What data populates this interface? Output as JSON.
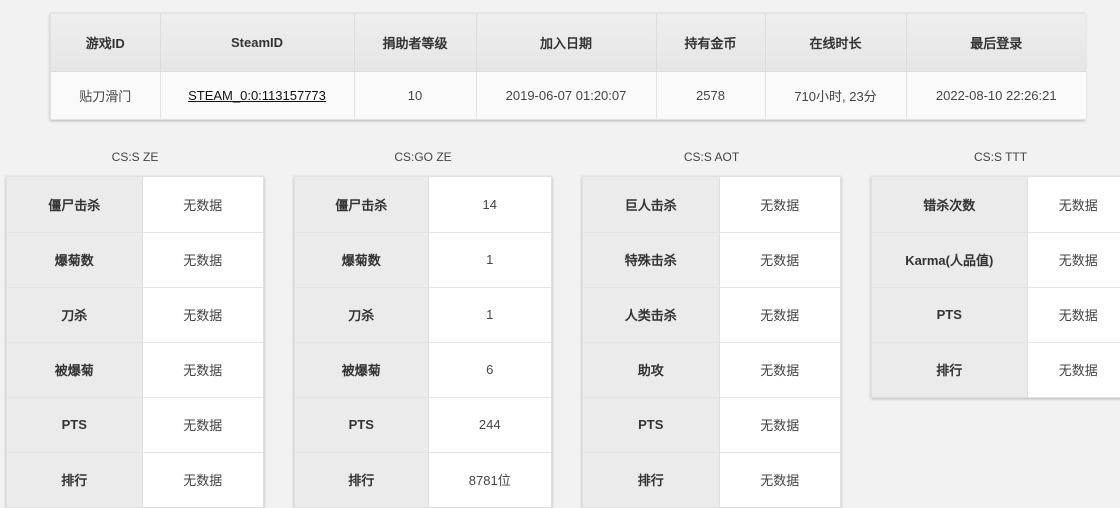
{
  "profile": {
    "headers": [
      "游戏ID",
      "SteamID",
      "捐助者等级",
      "加入日期",
      "持有金币",
      "在线时长",
      "最后登录"
    ],
    "values": {
      "game_id": "贴刀滑门",
      "steam_id": "STEAM_0:0:113157773",
      "donor_level": "10",
      "join_date": "2019-06-07 01:20:07",
      "coins": "2578",
      "online_time": "710小时, 23分",
      "last_login": "2022-08-10 22:26:21"
    }
  },
  "sections": [
    {
      "title": "CS:S ZE",
      "rows": [
        {
          "label": "僵尸击杀",
          "value": "无数据"
        },
        {
          "label": "爆菊数",
          "value": "无数据"
        },
        {
          "label": "刀杀",
          "value": "无数据"
        },
        {
          "label": "被爆菊",
          "value": "无数据"
        },
        {
          "label": "PTS",
          "value": "无数据"
        },
        {
          "label": "排行",
          "value": "无数据"
        }
      ]
    },
    {
      "title": "CS:GO ZE",
      "rows": [
        {
          "label": "僵尸击杀",
          "value": "14"
        },
        {
          "label": "爆菊数",
          "value": "1"
        },
        {
          "label": "刀杀",
          "value": "1"
        },
        {
          "label": "被爆菊",
          "value": "6"
        },
        {
          "label": "PTS",
          "value": "244"
        },
        {
          "label": "排行",
          "value": "8781位"
        }
      ]
    },
    {
      "title": "CS:S AOT",
      "rows": [
        {
          "label": "巨人击杀",
          "value": "无数据"
        },
        {
          "label": "特殊击杀",
          "value": "无数据"
        },
        {
          "label": "人类击杀",
          "value": "无数据"
        },
        {
          "label": "助攻",
          "value": "无数据"
        },
        {
          "label": "PTS",
          "value": "无数据"
        },
        {
          "label": "排行",
          "value": "无数据"
        }
      ]
    },
    {
      "title": "CS:S TTT",
      "rows": [
        {
          "label": "错杀次数",
          "value": "无数据"
        },
        {
          "label": "Karma(人品值)",
          "value": "无数据"
        },
        {
          "label": "PTS",
          "value": "无数据"
        },
        {
          "label": "排行",
          "value": "无数据"
        }
      ]
    }
  ]
}
